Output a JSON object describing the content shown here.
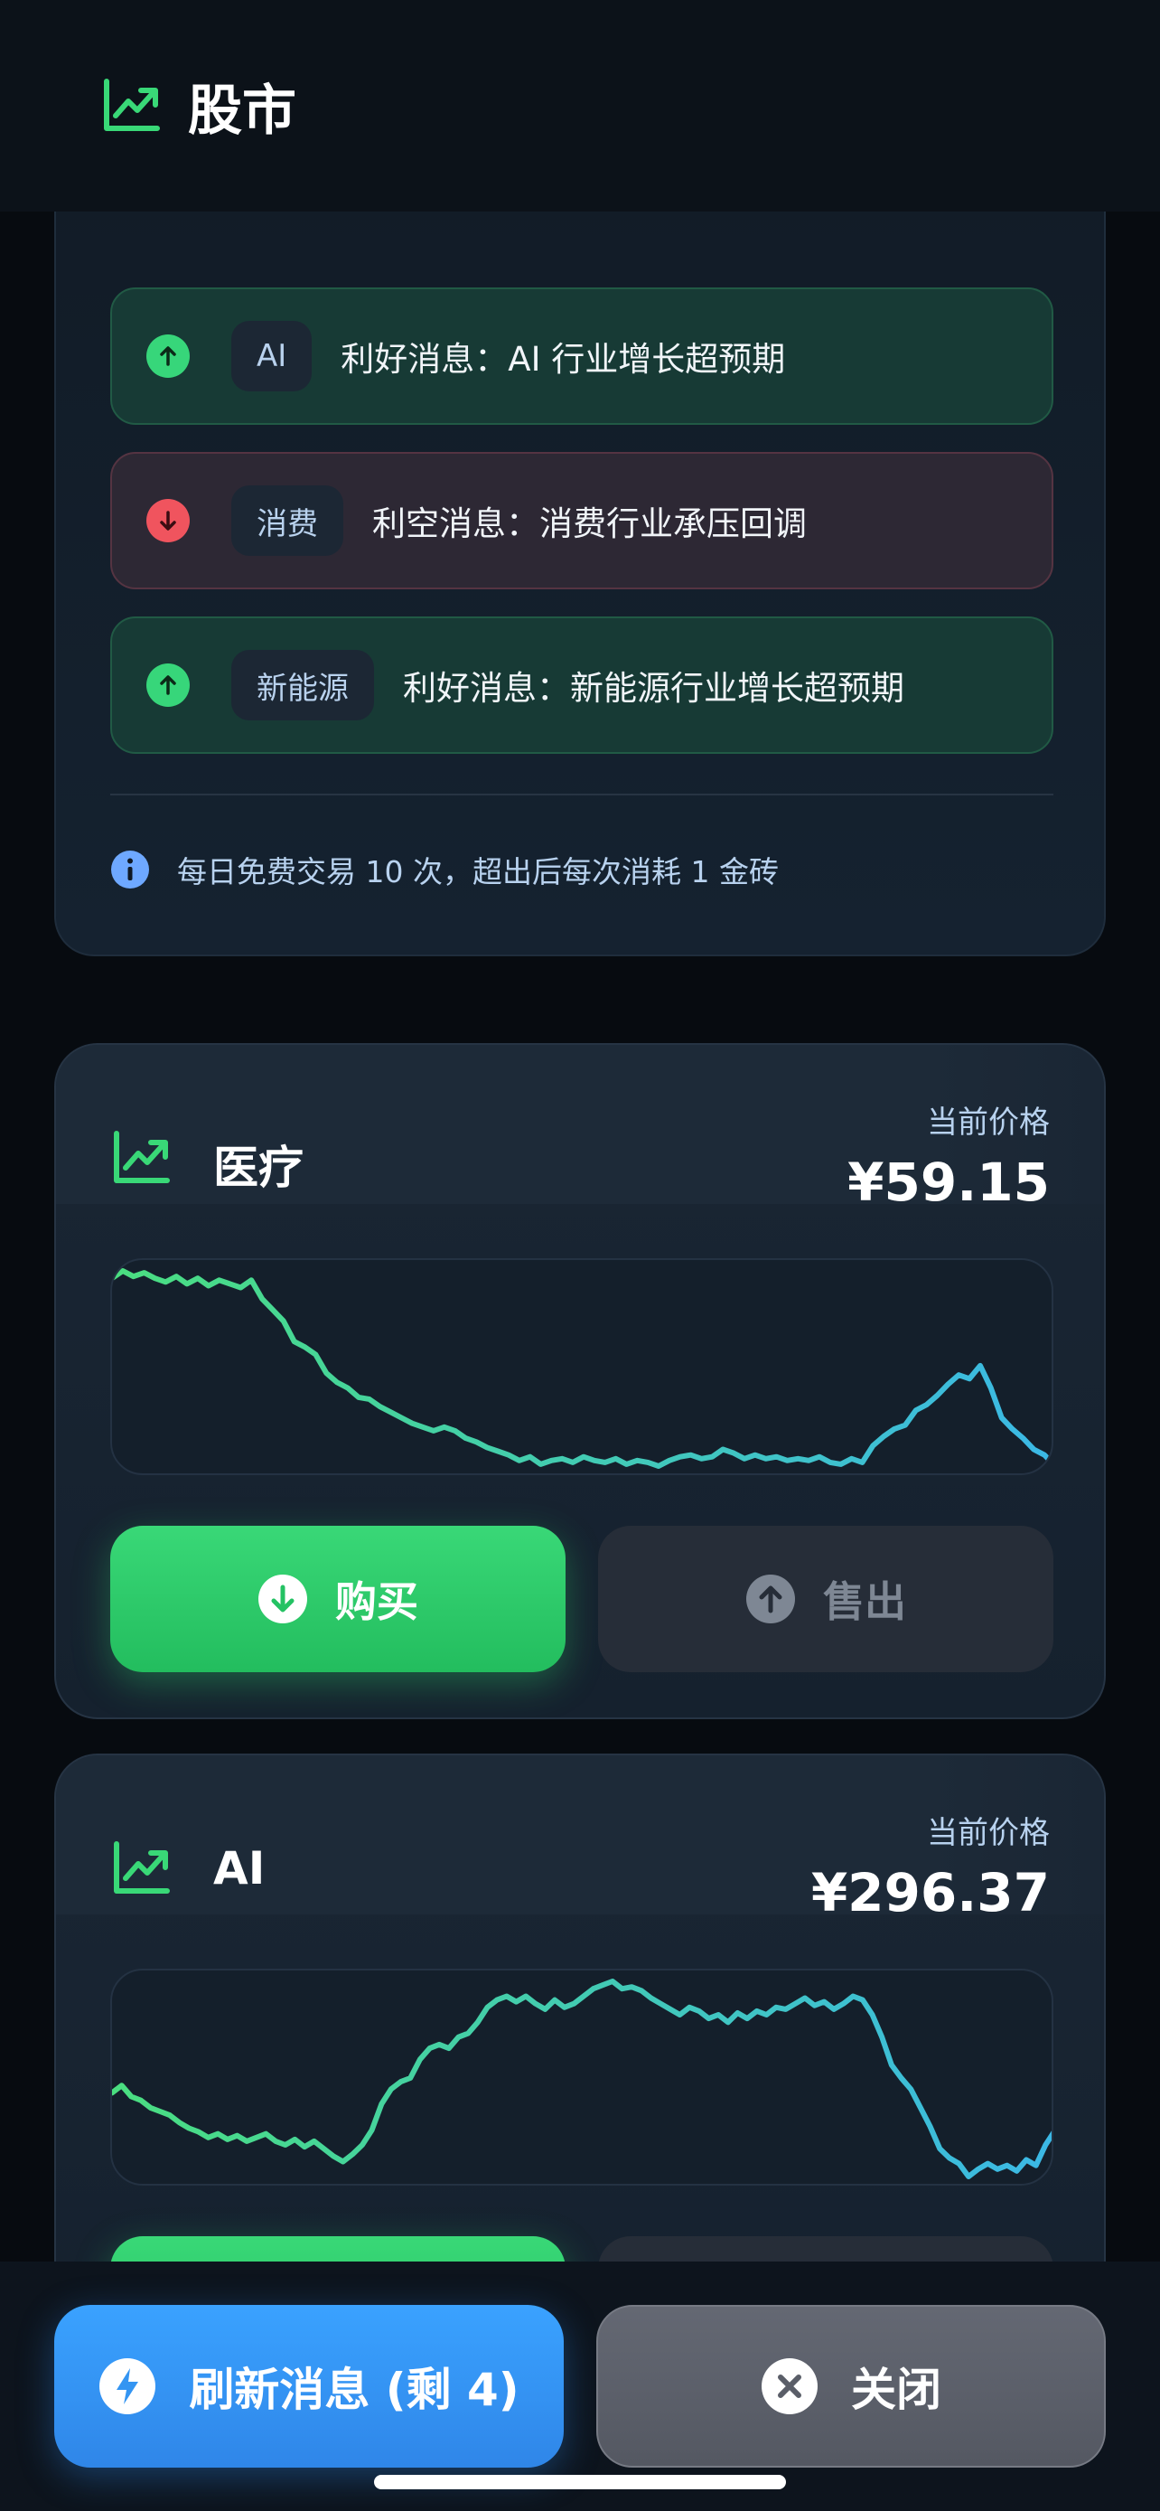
{
  "header": {
    "title": "股市",
    "icon": "chart-line-up-icon"
  },
  "news": {
    "items": [
      {
        "sentiment": "good",
        "tag": "AI",
        "text": "利好消息：AI 行业增长超预期"
      },
      {
        "sentiment": "bad",
        "tag": "消费",
        "text": "利空消息：消费行业承压回调"
      },
      {
        "sentiment": "good",
        "tag": "新能源",
        "text": "利好消息：新能源行业增长超预期"
      }
    ],
    "info": "每日免费交易 10 次，超出后每次消耗 1 金砖"
  },
  "stocks": [
    {
      "name": "医疗",
      "price_label": "当前价格",
      "price": "¥59.15",
      "buy_label": "购买",
      "sell_label": "售出"
    },
    {
      "name": "AI",
      "price_label": "当前价格",
      "price": "¥296.37"
    }
  ],
  "chart_data": [
    {
      "type": "line",
      "title": "",
      "xlabel": "",
      "ylabel": "",
      "grid": false,
      "values": [
        0.95,
        0.99,
        0.96,
        0.98,
        0.95,
        0.93,
        0.96,
        0.92,
        0.95,
        0.91,
        0.94,
        0.92,
        0.9,
        0.94,
        0.84,
        0.78,
        0.72,
        0.61,
        0.58,
        0.54,
        0.44,
        0.39,
        0.36,
        0.31,
        0.3,
        0.26,
        0.23,
        0.2,
        0.17,
        0.15,
        0.13,
        0.15,
        0.13,
        0.09,
        0.07,
        0.04,
        0.02,
        0.0,
        -0.03,
        -0.01,
        -0.05,
        -0.03,
        -0.02,
        -0.04,
        -0.01,
        -0.03,
        -0.04,
        -0.02,
        -0.05,
        -0.03,
        -0.04,
        -0.06,
        -0.03,
        -0.01,
        0.0,
        -0.02,
        -0.01,
        0.03,
        0.01,
        -0.02,
        0.0,
        -0.02,
        -0.01,
        -0.03,
        -0.02,
        -0.03,
        -0.01,
        -0.04,
        -0.05,
        -0.02,
        -0.04,
        0.05,
        0.1,
        0.14,
        0.16,
        0.24,
        0.27,
        0.32,
        0.38,
        0.43,
        0.41,
        0.48,
        0.36,
        0.2,
        0.14,
        0.09,
        0.03,
        0.0,
        -0.06
      ],
      "line_colors": [
        "#4ade80",
        "#3bb8e6"
      ]
    },
    {
      "type": "line",
      "title": "",
      "xlabel": "",
      "ylabel": "",
      "grid": false,
      "values": [
        0.4,
        0.44,
        0.38,
        0.36,
        0.32,
        0.3,
        0.28,
        0.24,
        0.21,
        0.19,
        0.16,
        0.18,
        0.15,
        0.17,
        0.14,
        0.16,
        0.18,
        0.14,
        0.12,
        0.15,
        0.11,
        0.14,
        0.1,
        0.06,
        0.03,
        0.07,
        0.12,
        0.2,
        0.34,
        0.42,
        0.46,
        0.48,
        0.58,
        0.64,
        0.66,
        0.64,
        0.7,
        0.72,
        0.78,
        0.86,
        0.9,
        0.92,
        0.89,
        0.92,
        0.88,
        0.85,
        0.9,
        0.86,
        0.88,
        0.92,
        0.96,
        0.98,
        1.0,
        0.96,
        0.97,
        0.95,
        0.91,
        0.88,
        0.85,
        0.82,
        0.86,
        0.84,
        0.8,
        0.82,
        0.78,
        0.83,
        0.8,
        0.84,
        0.82,
        0.86,
        0.85,
        0.88,
        0.91,
        0.87,
        0.89,
        0.85,
        0.88,
        0.92,
        0.9,
        0.82,
        0.7,
        0.55,
        0.48,
        0.42,
        0.32,
        0.22,
        0.1,
        0.05,
        0.02,
        -0.05,
        -0.01,
        0.02,
        -0.01,
        0.01,
        -0.02,
        0.04,
        0.01,
        0.12,
        0.2
      ],
      "line_colors": [
        "#4ade80",
        "#3bb8e6"
      ]
    }
  ],
  "bottom": {
    "refresh_label": "刷新消息 (剩 4)",
    "close_label": "关闭"
  },
  "colors": {
    "up": "#37d67a",
    "down": "#f0545e",
    "accent_blue": "#3aa2ff",
    "buy_green": "#2fcf6a"
  }
}
